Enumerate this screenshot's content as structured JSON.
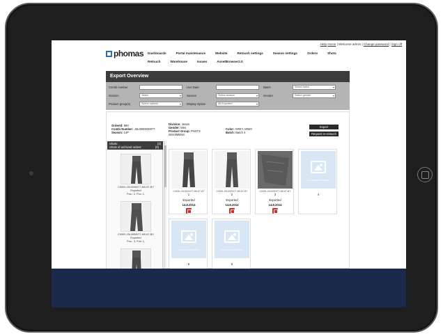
{
  "header": {
    "links": [
      "Help",
      "Home",
      "Welcome admin",
      "Change password",
      "Sign off"
    ],
    "logo": "phomas"
  },
  "nav": {
    "row1": [
      "Dashboards",
      "Portal maintenance",
      "Website",
      "Retouch settings",
      "Season settings",
      "Orders",
      "Shots"
    ],
    "row2": [
      "Retouch",
      "Warehouse",
      "Issues",
      "AssetBrowser2.0"
    ]
  },
  "panel": {
    "title": "Export Overview"
  },
  "filters": {
    "combi_label": "Combi number",
    "live_date_label": "Live Date",
    "batch_label": "Batch",
    "batch_select": "Select batch",
    "division_label": "Division",
    "division_value": "Jeans",
    "season_label": "Season",
    "season_select": "Select season",
    "gender_label": "Gender",
    "gender_select": "Select gender",
    "product_group_label": "Product group(s)",
    "product_group_select": "Select options",
    "display_option_label": "Display Option",
    "display_option_value": "All Exported"
  },
  "order": {
    "order_id_label": "OrderId:",
    "order_id": "890",
    "combi_label": "Combi Number:",
    "combi": "J3L0000030077",
    "season_label": "Season:",
    "season": "14P",
    "division_label": "Division:",
    "division": "Jeans",
    "gender_label": "Gender:",
    "gender": "Men",
    "product_group_label": "Product Group:",
    "product_group": "PANTS WSH/MENS",
    "color_label": "Color:",
    "color": "GREY ARMY",
    "batch_label": "Batch:",
    "batch": "Batch 4",
    "export_button": "Export",
    "request_button": "Request re-retouch"
  },
  "sidebar": {
    "shots_label": "Shots:",
    "shots_count": "(3)",
    "archived_label": "Shots of archived orders:",
    "archived_count": "(0)",
    "items": [
      {
        "code": "C0000-J3L0000077-M0-87-BY",
        "status": "Exported",
        "pos": "Pos.: 2, Pos: 1,"
      },
      {
        "code": "C0000-J3L0000077-M0-87-BY",
        "status": "Exported",
        "pos": "Pos.: 3, Pos: 1,"
      }
    ]
  },
  "cards": [
    {
      "code": "C0000-J3L0000077-M0-87-BY",
      "num": "1",
      "status": "Exported",
      "date": "14.8.2014",
      "type": "front"
    },
    {
      "code": "C0000-J3L0000077-M0-87-BY",
      "num": "2",
      "status": "Exported",
      "date": "14.8.2014",
      "type": "back"
    },
    {
      "code": "C0000-J3L0000077-M0-87-BY",
      "num": "3",
      "status": "Exported",
      "date": "14.8.2014",
      "type": "detail"
    },
    {
      "num": "4",
      "type": "placeholder"
    },
    {
      "num": "5",
      "type": "placeholder"
    },
    {
      "num": "6",
      "type": "placeholder"
    }
  ],
  "placeholder_text": "NO IMAGE AVAILABLE"
}
